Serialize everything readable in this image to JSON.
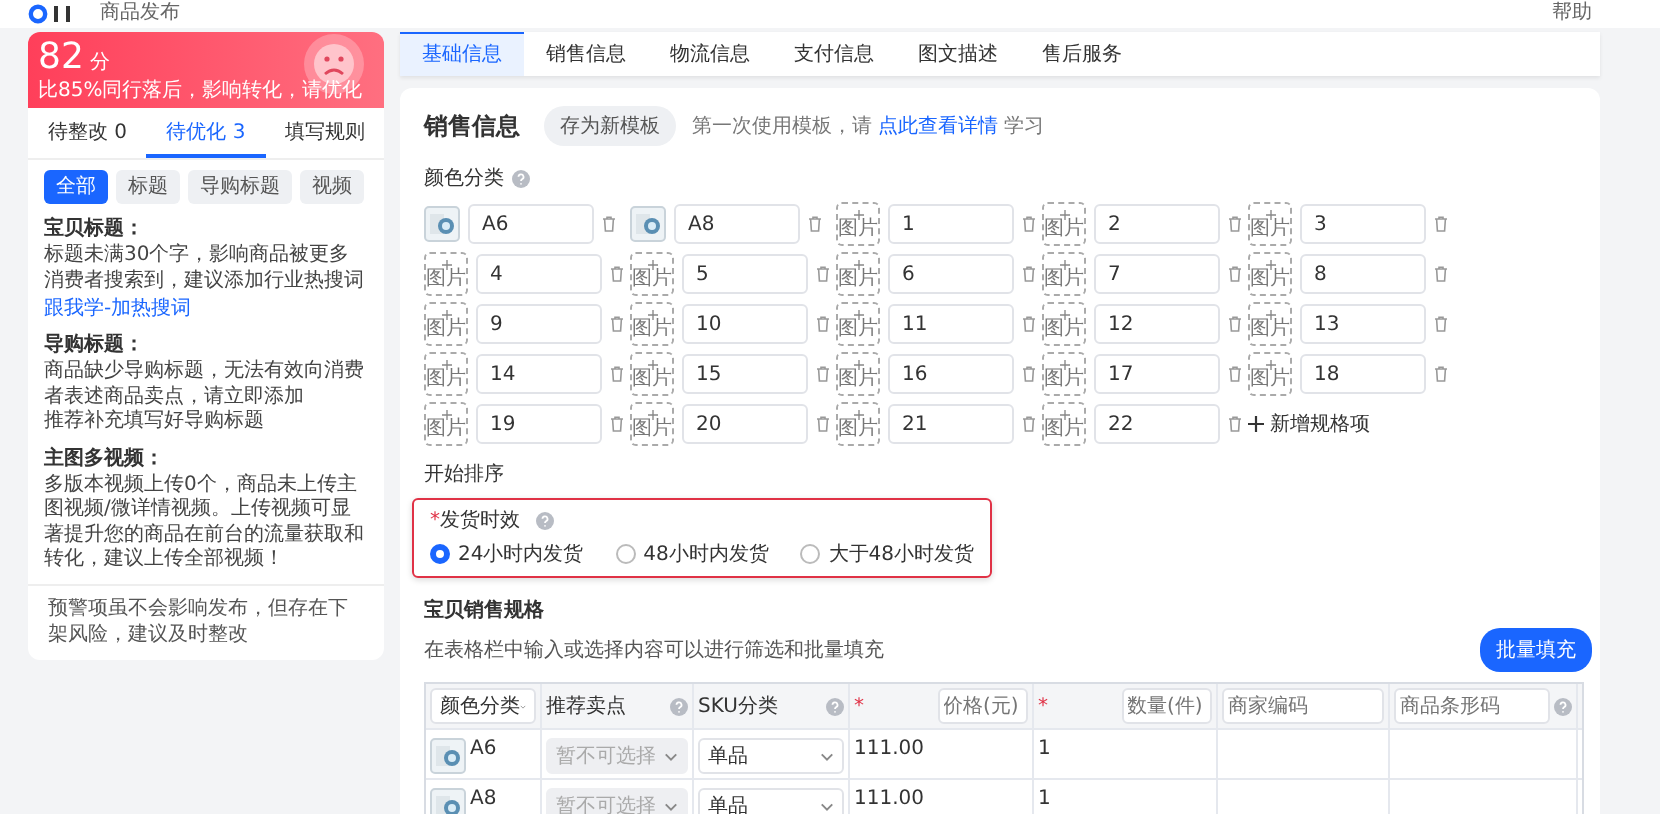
{
  "topbar": {
    "title": "商品发布",
    "help": "帮助"
  },
  "score": {
    "value": "82",
    "unit": "分",
    "note": "比85%同行落后，影响转化，请优化"
  },
  "side_tabs": [
    {
      "label": "待整改 0",
      "selected": false
    },
    {
      "label": "待优化 3",
      "selected": true
    },
    {
      "label": "填写规则",
      "selected": false
    }
  ],
  "filters": [
    {
      "label": "全部",
      "selected": true
    },
    {
      "label": "标题",
      "selected": false
    },
    {
      "label": "导购标题",
      "selected": false
    },
    {
      "label": "视频",
      "selected": false
    }
  ],
  "issues": [
    {
      "title": "宝贝标题：",
      "lines": [
        "标题未满30个字，影响商品被更多消费者搜索到，建议添加行业热搜词"
      ],
      "link": "跟我学-加热搜词"
    },
    {
      "title": "导购标题：",
      "lines": [
        "商品缺少导购标题，无法有效向消费者表述商品卖点，请立即添加",
        "推荐补充填写好导购标题"
      ]
    },
    {
      "title": "主图多视频：",
      "lines": [
        "多版本视频上传0个，商品未上传主图视频/微详情视频。上传视频可显著提升您的商品在前台的流量获取和转化，建议上传全部视频！"
      ]
    }
  ],
  "notice": "预警项虽不会影响发布，但存在下架风险，建议及时整改",
  "tabs": [
    {
      "label": "基础信息",
      "selected": true
    },
    {
      "label": "销售信息",
      "selected": false
    },
    {
      "label": "物流信息",
      "selected": false
    },
    {
      "label": "支付信息",
      "selected": false
    },
    {
      "label": "图文描述",
      "selected": false
    },
    {
      "label": "售后服务",
      "selected": false
    }
  ],
  "sales": {
    "title": "销售信息",
    "template_button": "存为新模板",
    "hint_before": "第一次使用模板，请",
    "hint_link": "点此查看详情",
    "hint_after": "学习"
  },
  "color": {
    "label": "颜色分类",
    "items": [
      {
        "kind": "photo",
        "value": "A6"
      },
      {
        "kind": "photo",
        "value": "A8"
      },
      {
        "kind": "upload",
        "upload_label": "图片",
        "value": "1"
      },
      {
        "kind": "upload",
        "upload_label": "图片",
        "value": "2"
      },
      {
        "kind": "upload",
        "upload_label": "图片",
        "value": "3"
      },
      {
        "kind": "upload",
        "upload_label": "图片",
        "value": "4"
      },
      {
        "kind": "upload",
        "upload_label": "图片",
        "value": "5"
      },
      {
        "kind": "upload",
        "upload_label": "图片",
        "value": "6"
      },
      {
        "kind": "upload",
        "upload_label": "图片",
        "value": "7"
      },
      {
        "kind": "upload",
        "upload_label": "图片",
        "value": "8"
      },
      {
        "kind": "upload",
        "upload_label": "图片",
        "value": "9"
      },
      {
        "kind": "upload",
        "upload_label": "图片",
        "value": "10"
      },
      {
        "kind": "upload",
        "upload_label": "图片",
        "value": "11"
      },
      {
        "kind": "upload",
        "upload_label": "图片",
        "value": "12"
      },
      {
        "kind": "upload",
        "upload_label": "图片",
        "value": "13"
      },
      {
        "kind": "upload",
        "upload_label": "图片",
        "value": "14"
      },
      {
        "kind": "upload",
        "upload_label": "图片",
        "value": "15"
      },
      {
        "kind": "upload",
        "upload_label": "图片",
        "value": "16"
      },
      {
        "kind": "upload",
        "upload_label": "图片",
        "value": "17"
      },
      {
        "kind": "upload",
        "upload_label": "图片",
        "value": "18"
      },
      {
        "kind": "upload",
        "upload_label": "图片",
        "value": "19"
      },
      {
        "kind": "upload",
        "upload_label": "图片",
        "value": "20"
      },
      {
        "kind": "upload",
        "upload_label": "图片",
        "value": "21"
      },
      {
        "kind": "upload",
        "upload_label": "图片",
        "value": "22"
      }
    ],
    "add_label": "新增规格项"
  },
  "sort_label": "开始排序",
  "shipping": {
    "required_mark": "*",
    "label": "发货时效",
    "options": [
      {
        "label": "24小时内发货",
        "selected": true
      },
      {
        "label": "48小时内发货",
        "selected": false
      },
      {
        "label": "大于48小时发货",
        "selected": false
      }
    ]
  },
  "spec": {
    "title": "宝贝销售规格",
    "hint": "在表格栏中输入或选择内容可以进行筛选和批量填充",
    "batch_button": "批量填充",
    "columns": [
      {
        "kind": "select",
        "label": "颜色分类"
      },
      {
        "kind": "label",
        "label": "推荐卖点",
        "help": true
      },
      {
        "kind": "label",
        "label": "SKU分类",
        "help": true
      },
      {
        "kind": "input",
        "placeholder": "价格(元)",
        "required_mark": "*"
      },
      {
        "kind": "input",
        "placeholder": "数量(件)",
        "required_mark": "*"
      },
      {
        "kind": "input",
        "placeholder": "商家编码"
      },
      {
        "kind": "input",
        "placeholder": "商品条形码",
        "help": true
      }
    ],
    "rows": [
      {
        "color_name": "A6",
        "selling_point": "暂不可选择",
        "selling_point_disabled": true,
        "sku": "单品",
        "price": "111.00",
        "quantity": "1"
      },
      {
        "color_name": "A8",
        "selling_point": "暂不可选择",
        "selling_point_disabled": true,
        "sku": "单品",
        "price": "111.00",
        "quantity": "1"
      }
    ]
  }
}
